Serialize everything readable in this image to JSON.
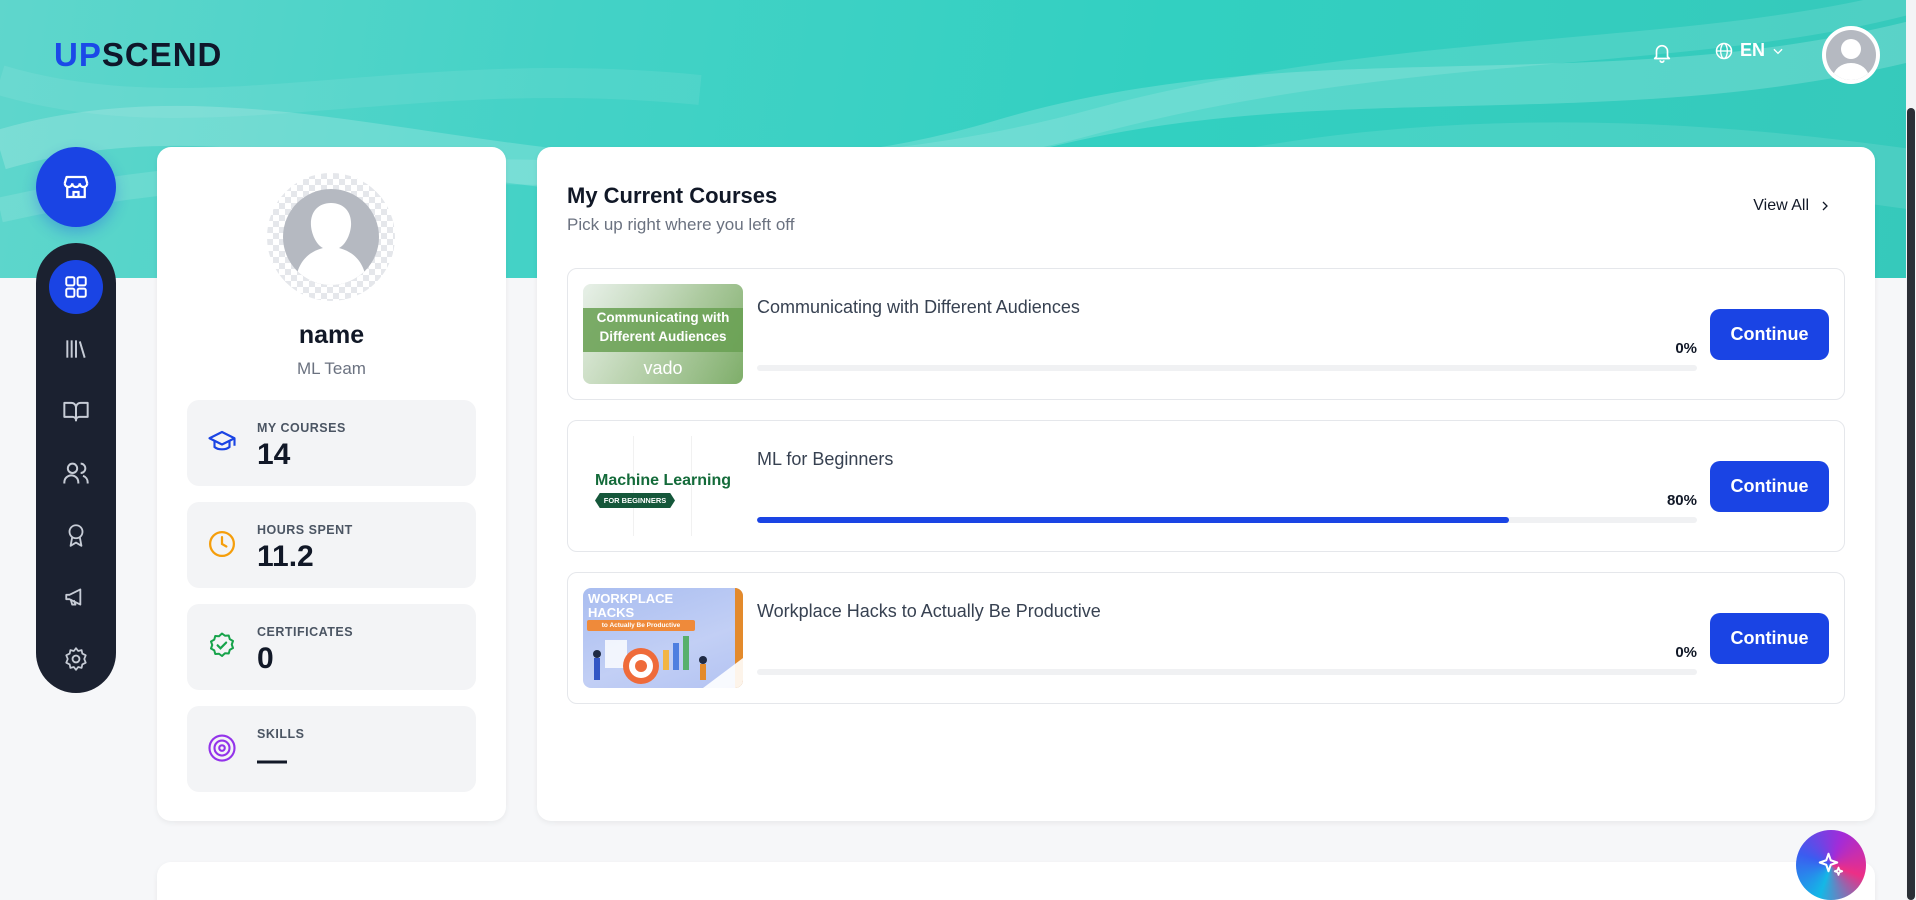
{
  "header": {
    "logo_up": "UP",
    "logo_scend": "SCEND",
    "language": "EN"
  },
  "profile": {
    "name": "name",
    "team": "ML Team",
    "stats": [
      {
        "label": "MY COURSES",
        "value": "14",
        "icon": "graduation-cap-icon"
      },
      {
        "label": "HOURS SPENT",
        "value": "11.2",
        "icon": "clock-icon"
      },
      {
        "label": "CERTIFICATES",
        "value": "0",
        "icon": "badge-check-icon"
      },
      {
        "label": "SKILLS",
        "value": "—",
        "icon": "target-icon"
      }
    ]
  },
  "courses": {
    "title": "My Current Courses",
    "subtitle": "Pick up right where you left off",
    "view_all": "View All",
    "continue_label": "Continue",
    "items": [
      {
        "title": "Communicating with Different Audiences",
        "progress": 0,
        "progress_label": "0%",
        "thumb_text": "Communicating with Different Audiences",
        "thumb_brand": "vado"
      },
      {
        "title": "ML for Beginners",
        "progress": 80,
        "progress_label": "80%",
        "thumb_text": "Machine Learning",
        "thumb_sub": "FOR BEGINNERS"
      },
      {
        "title": "Workplace Hacks to Actually Be Productive",
        "progress": 0,
        "progress_label": "0%",
        "thumb_text": "WORKPLACE HACKS",
        "thumb_sub": "to Actually Be Productive"
      }
    ]
  },
  "colors": {
    "primary": "#1a44e4",
    "sidebar": "#1b2130",
    "banner": "#32d0c1"
  }
}
